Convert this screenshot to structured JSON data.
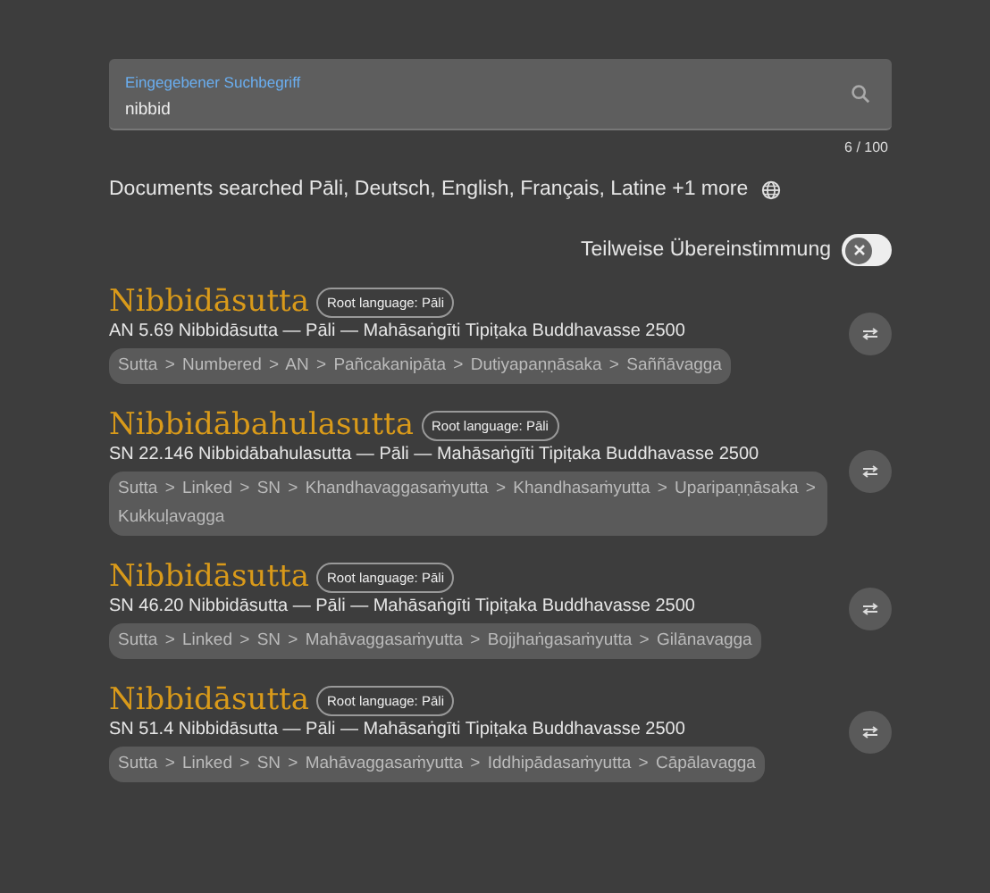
{
  "search": {
    "label": "Eingegebener Suchbegriff",
    "value": "nibbid",
    "counter": "6 / 100"
  },
  "languages": {
    "text": "Documents searched Pāli, Deutsch, English, Français, Latine +1 more"
  },
  "partial_match": {
    "label": "Teilweise Übereinstimmung",
    "on": false
  },
  "results": [
    {
      "title": "Nibbidāsutta",
      "badge": "Root language: Pāli",
      "reference": "AN 5.69 Nibbidāsutta — Pāli — Mahāsaṅgīti Tipiṭaka Buddhavasse 2500",
      "path": "Sutta > Numbered > AN > Pañcakanipāta > Dutiyapaṇṇāsaka > Saññāvagga"
    },
    {
      "title": "Nibbidābahulasutta",
      "badge": "Root language: Pāli",
      "reference": "SN 22.146 Nibbidābahulasutta — Pāli — Mahāsaṅgīti Tipiṭaka Buddhavasse 2500",
      "path": "Sutta > Linked > SN > Khandhavaggasaṁyutta > Khandhasaṁyutta > Uparipaṇṇāsaka > Kukkuḷavagga"
    },
    {
      "title": "Nibbidāsutta",
      "badge": "Root language: Pāli",
      "reference": "SN 46.20 Nibbidāsutta — Pāli — Mahāsaṅgīti Tipiṭaka Buddhavasse 2500",
      "path": "Sutta > Linked > SN > Mahāvaggasaṁyutta > Bojjhaṅgasaṁyutta > Gilānavagga"
    },
    {
      "title": "Nibbidāsutta",
      "badge": "Root language: Pāli",
      "reference": "SN 51.4 Nibbidāsutta — Pāli — Mahāsaṅgīti Tipiṭaka Buddhavasse 2500",
      "path": "Sutta > Linked > SN > Mahāvaggasaṁyutta > Iddhipādasaṁyutta > Cāpālavagga"
    }
  ]
}
